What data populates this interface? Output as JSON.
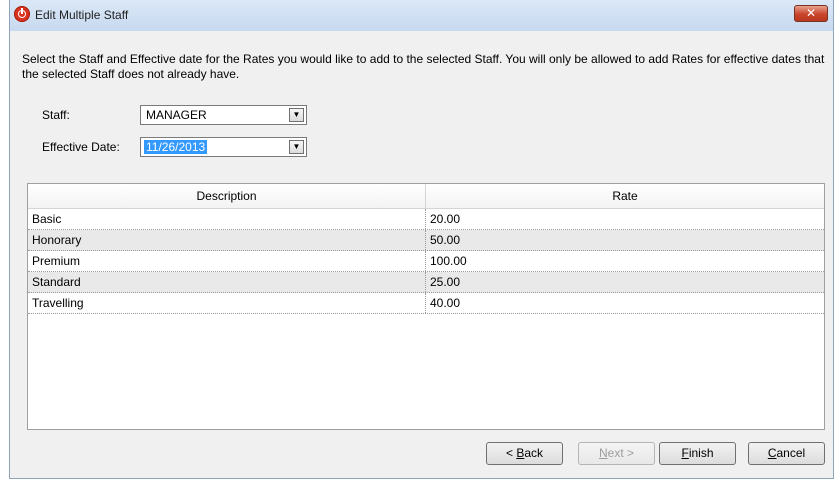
{
  "window": {
    "title": "Edit Multiple Staff",
    "close_label": "✕"
  },
  "instructions": "Select the Staff and Effective date for the Rates you would like to add to the selected Staff.  You will only be allowed to add Rates for effective dates that the selected Staff does not already have.",
  "form": {
    "staff_label": "Staff:",
    "staff_value": "MANAGER",
    "effective_date_label": "Effective Date:",
    "effective_date_value": "11/26/2013"
  },
  "grid": {
    "columns": [
      "Description",
      "Rate"
    ],
    "rows": [
      {
        "description": "Basic",
        "rate": "20.00"
      },
      {
        "description": "Honorary",
        "rate": "50.00"
      },
      {
        "description": "Premium",
        "rate": "100.00"
      },
      {
        "description": "Standard",
        "rate": "25.00"
      },
      {
        "description": "Travelling",
        "rate": "40.00"
      }
    ]
  },
  "buttons": {
    "back": {
      "prefix": "< ",
      "mnemonic": "B",
      "rest": "ack"
    },
    "next": {
      "mnemonic": "N",
      "rest": "ext >"
    },
    "finish": {
      "mnemonic": "F",
      "rest": "inish"
    },
    "cancel": {
      "mnemonic": "C",
      "rest": "ancel"
    }
  },
  "colors": {
    "accent_selection": "#3399ff",
    "close_button": "#c9442a",
    "app_icon": "#d9321e"
  }
}
